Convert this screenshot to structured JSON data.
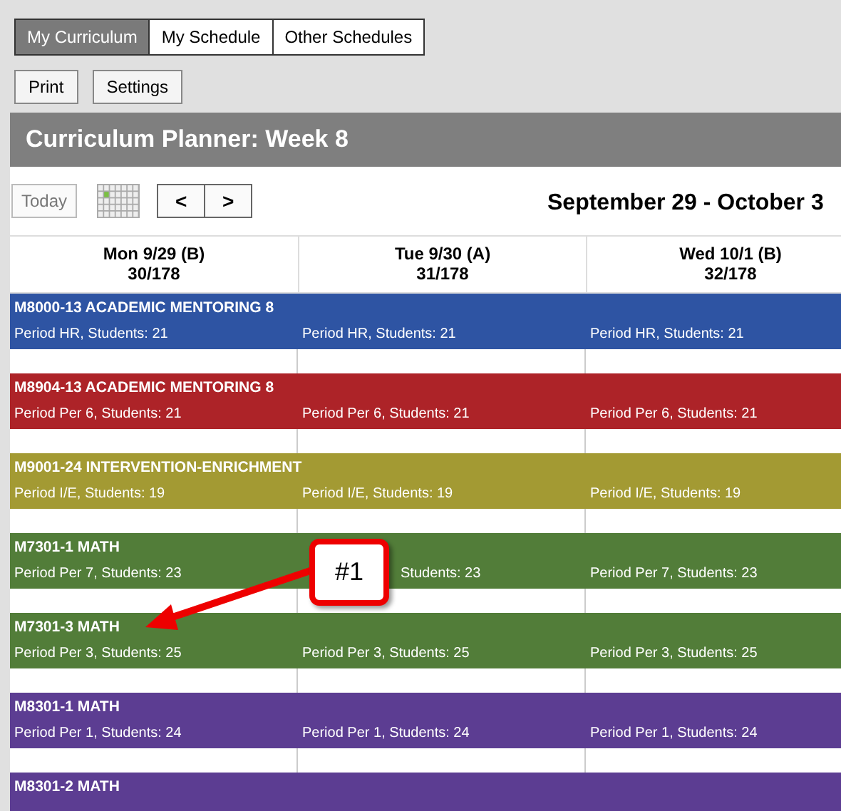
{
  "tabs": [
    {
      "label": "My Curriculum",
      "selected": true
    },
    {
      "label": "My Schedule",
      "selected": false
    },
    {
      "label": "Other Schedules",
      "selected": false
    }
  ],
  "actions": [
    "Print",
    "Settings"
  ],
  "planner": {
    "title": "Curriculum Planner: Week 8",
    "today_button": "Today",
    "prev_button": "<",
    "next_button": ">",
    "date_range": "September 29 - October 3"
  },
  "days": [
    {
      "label": "Mon 9/29 (B)",
      "count": "30/178"
    },
    {
      "label": "Tue 9/30 (A)",
      "count": "31/178"
    },
    {
      "label": "Wed 10/1 (B)",
      "count": "32/178"
    }
  ],
  "courses": [
    {
      "title": "M8000-13 ACADEMIC MENTORING 8",
      "color": "#2e54a3",
      "periods": [
        "Period HR, Students: 21",
        "Period HR, Students: 21",
        "Period HR, Students: 21"
      ]
    },
    {
      "title": "M8904-13 ACADEMIC MENTORING 8",
      "color": "#ad2328",
      "periods": [
        "Period Per 6, Students: 21",
        "Period Per 6, Students: 21",
        "Period Per 6, Students: 21"
      ]
    },
    {
      "title": "M9001-24 INTERVENTION-ENRICHMENT",
      "color": "#a39a33",
      "periods": [
        "Period I/E, Students: 19",
        "Period I/E, Students: 19",
        "Period I/E, Students: 19"
      ]
    },
    {
      "title": "M7301-1 MATH",
      "color": "#527d39",
      "periods": [
        "Period Per 7, Students: 23",
        "Students: 23",
        "Period Per 7, Students: 23"
      ]
    },
    {
      "title": "M7301-3 MATH",
      "color": "#527d39",
      "periods": [
        "Period Per 3, Students: 25",
        "Period Per 3, Students: 25",
        "Period Per 3, Students: 25"
      ]
    },
    {
      "title": "M8301-1 MATH",
      "color": "#5c3d92",
      "periods": [
        "Period Per 1, Students: 24",
        "Period Per 1, Students: 24",
        "Period Per 1, Students: 24"
      ]
    },
    {
      "title": "M8301-2 MATH",
      "color": "#5c3d92"
    }
  ],
  "callout": {
    "label": "#1"
  }
}
